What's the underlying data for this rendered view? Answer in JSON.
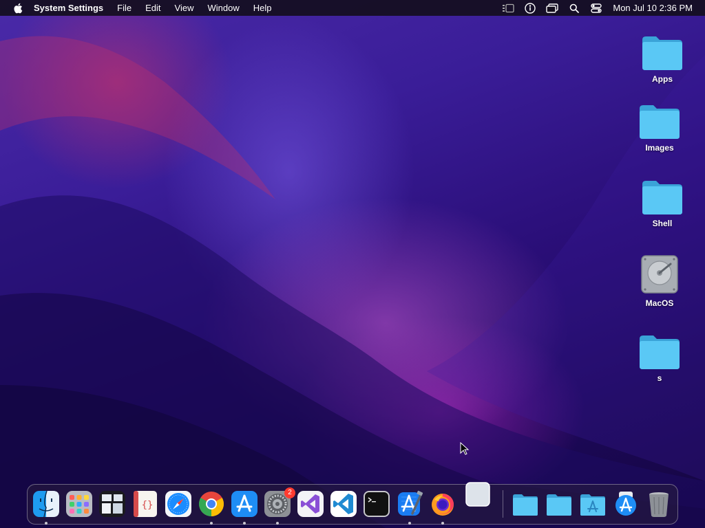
{
  "menubar": {
    "app_name": "System Settings",
    "menus": [
      "File",
      "Edit",
      "View",
      "Window",
      "Help"
    ],
    "clock": "Mon Jul 10  2:36 PM"
  },
  "desktop": {
    "icons": [
      {
        "label": "Apps",
        "type": "folder"
      },
      {
        "label": "Images",
        "type": "folder"
      },
      {
        "label": "Shell",
        "type": "folder"
      },
      {
        "label": "MacOS",
        "type": "drive"
      },
      {
        "label": "s",
        "type": "folder"
      }
    ]
  },
  "dock": {
    "apps": [
      {
        "name": "finder-icon",
        "running": true
      },
      {
        "name": "launchpad-icon",
        "running": false
      },
      {
        "name": "mission-control-icon",
        "running": false
      },
      {
        "name": "script-editor-icon",
        "running": false
      },
      {
        "name": "safari-icon",
        "running": false
      },
      {
        "name": "chrome-icon",
        "running": true
      },
      {
        "name": "app-store-icon",
        "running": true
      },
      {
        "name": "system-settings-icon",
        "running": true,
        "badge": "2"
      },
      {
        "name": "visual-studio-icon",
        "running": false
      },
      {
        "name": "vscode-icon",
        "running": false
      },
      {
        "name": "terminal-icon",
        "running": false
      },
      {
        "name": "xcode-icon",
        "running": true
      },
      {
        "name": "firefox-icon",
        "running": true
      },
      {
        "name": "blank-window-icon",
        "running": false
      }
    ],
    "stacks": [
      {
        "name": "folder-stack-icon"
      },
      {
        "name": "folder-stack-icon"
      },
      {
        "name": "applications-folder-icon"
      },
      {
        "name": "app-store-downloads-icon"
      },
      {
        "name": "trash-icon"
      }
    ]
  },
  "colors": {
    "folder": "#5ac8f5",
    "badge": "#ff3b30",
    "menubar_bg": "#140e1e"
  }
}
